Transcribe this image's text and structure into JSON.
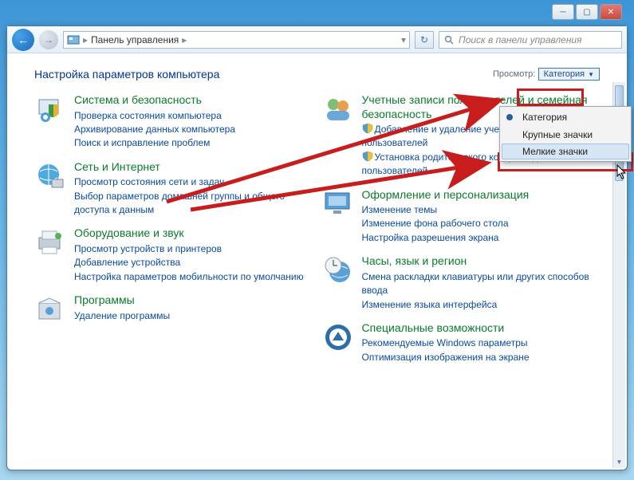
{
  "window": {
    "breadcrumb_label": "Панель управления",
    "breadcrumb_sep": "▸",
    "search_placeholder": "Поиск в панели управления"
  },
  "header": {
    "title": "Настройка параметров компьютера",
    "view_label": "Просмотр:",
    "view_value": "Категория"
  },
  "menu": {
    "items": [
      "Категория",
      "Крупные значки",
      "Мелкие значки"
    ]
  },
  "categories": {
    "left": [
      {
        "title": "Система и безопасность",
        "links": [
          "Проверка состояния компьютера",
          "Архивирование данных компьютера",
          "Поиск и исправление проблем"
        ],
        "icon": "shield-monitor"
      },
      {
        "title": "Сеть и Интернет",
        "links": [
          "Просмотр состояния сети и задач",
          "Выбор параметров домашней группы и общего доступа к данным"
        ],
        "icon": "globe-net"
      },
      {
        "title": "Оборудование и звук",
        "links": [
          "Просмотр устройств и принтеров",
          "Добавление устройства",
          "Настройка параметров мобильности по умолчанию"
        ],
        "icon": "printer"
      },
      {
        "title": "Программы",
        "links": [
          "Удаление программы"
        ],
        "icon": "box"
      }
    ],
    "right": [
      {
        "title": "Учетные записи пользователей и семейная безопасность",
        "shielded_links": [
          "Добавление и удаление учетных записей пользователей",
          "Установка родительского контроля для всех пользователей"
        ],
        "icon": "people"
      },
      {
        "title": "Оформление и персонализация",
        "links": [
          "Изменение темы",
          "Изменение фона рабочего стола",
          "Настройка разрешения экрана"
        ],
        "icon": "monitor"
      },
      {
        "title": "Часы, язык и регион",
        "links": [
          "Смена раскладки клавиатуры или других способов ввода",
          "Изменение языка интерфейса"
        ],
        "icon": "clock-globe"
      },
      {
        "title": "Специальные возможности",
        "links": [
          "Рекомендуемые Windows параметры",
          "Оптимизация изображения на экране"
        ],
        "icon": "ease"
      }
    ]
  }
}
